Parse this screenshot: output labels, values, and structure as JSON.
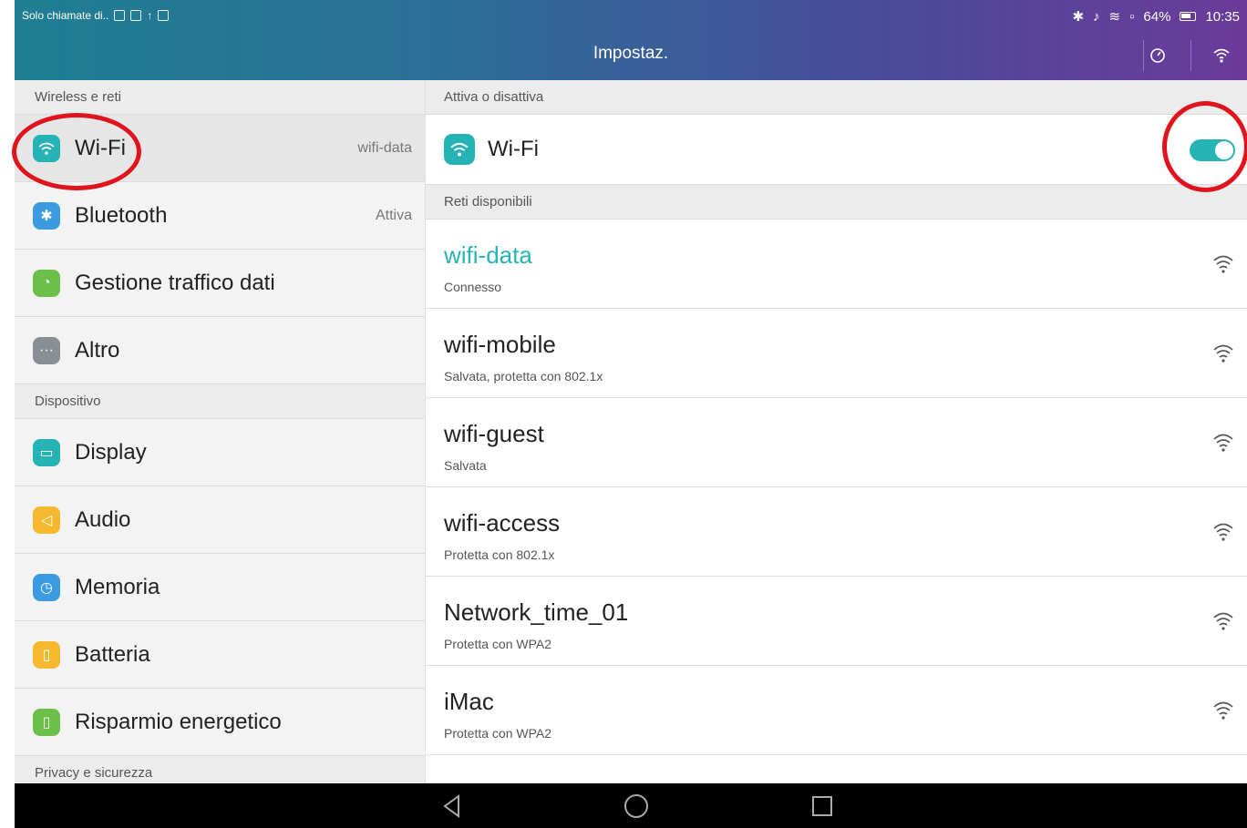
{
  "status_bar": {
    "left_text": "Solo chiamate di..",
    "battery_percent": "64%",
    "time": "10:35"
  },
  "title_bar": {
    "title": "Impostaz."
  },
  "left_pane": {
    "section_wireless": "Wireless e reti",
    "section_device": "Dispositivo",
    "section_privacy": "Privacy e sicurezza",
    "items": [
      {
        "label": "Wi-Fi",
        "value": "wifi-data",
        "icon": "wifi-icon",
        "color": "#26b3b5"
      },
      {
        "label": "Bluetooth",
        "value": "Attiva",
        "icon": "bluetooth-icon",
        "color": "#3a9be0"
      },
      {
        "label": "Gestione traffico dati",
        "value": "",
        "icon": "data-usage-icon",
        "color": "#6cc04a"
      },
      {
        "label": "Altro",
        "value": "",
        "icon": "more-icon",
        "color": "#8a8f96"
      },
      {
        "label": "Display",
        "value": "",
        "icon": "display-icon",
        "color": "#26b3b5"
      },
      {
        "label": "Audio",
        "value": "",
        "icon": "audio-icon",
        "color": "#f5b82e"
      },
      {
        "label": "Memoria",
        "value": "",
        "icon": "memory-icon",
        "color": "#3a9be0"
      },
      {
        "label": "Batteria",
        "value": "",
        "icon": "battery-icon",
        "color": "#f5b82e"
      },
      {
        "label": "Risparmio energetico",
        "value": "",
        "icon": "power-saving-icon",
        "color": "#6cc04a"
      }
    ]
  },
  "right_pane": {
    "header_toggle": "Attiva o disattiva",
    "wifi_label": "Wi-Fi",
    "wifi_enabled": true,
    "header_networks": "Reti disponibili",
    "networks": [
      {
        "name": "wifi-data",
        "status": "Connesso",
        "connected": true
      },
      {
        "name": "wifi-mobile",
        "status": "Salvata, protetta con 802.1x",
        "connected": false
      },
      {
        "name": "wifi-guest",
        "status": "Salvata",
        "connected": false
      },
      {
        "name": "wifi-access",
        "status": "Protetta con 802.1x",
        "connected": false
      },
      {
        "name": "Network_time_01",
        "status": "Protetta con WPA2",
        "connected": false
      },
      {
        "name": "iMac",
        "status": "Protetta con WPA2",
        "connected": false
      }
    ]
  },
  "colors": {
    "accent": "#26b3b5",
    "annotation": "#e0141c"
  }
}
